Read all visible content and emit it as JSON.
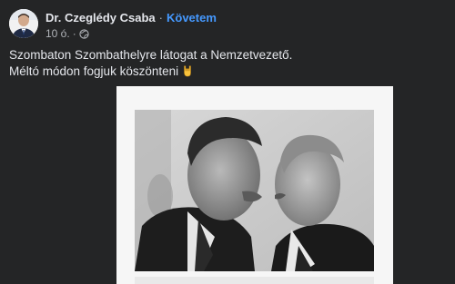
{
  "post": {
    "author": "Dr. Czeglédy Csaba",
    "separator": "·",
    "follow_label": "Követem",
    "time": "10 ó.",
    "meta_separator": "·",
    "lines": [
      "Szombaton Szombathelyre látogat a Nemzetvezető.",
      "Méltó módon fogjuk köszönteni"
    ],
    "emoji_icon": "rock-hand-icon",
    "audience_icon": "globe-icon"
  },
  "colors": {
    "background": "#242526",
    "text_primary": "#e4e6eb",
    "text_secondary": "#b0b3b8",
    "link": "#4599ff"
  }
}
